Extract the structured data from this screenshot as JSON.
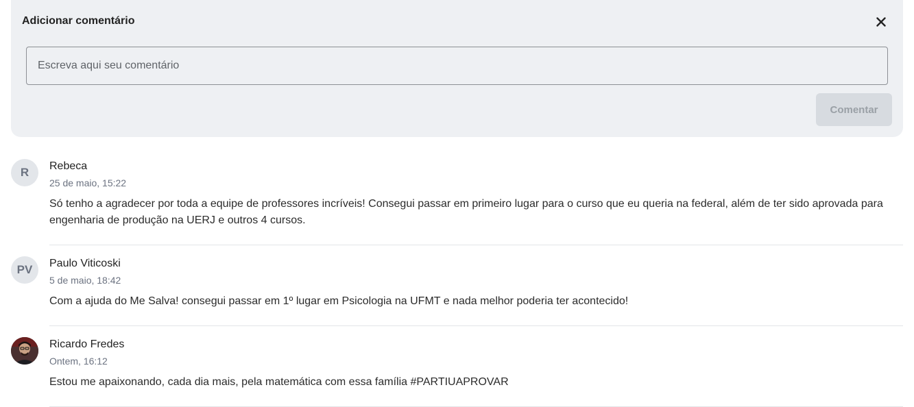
{
  "composer": {
    "title": "Adicionar comentário",
    "placeholder": "Escreva aqui seu comentário",
    "value": "",
    "submit_label": "Comentar"
  },
  "comments": [
    {
      "initials": "R",
      "author": "Rebeca",
      "date": "25 de maio, 15:22",
      "text": "Só tenho a agradecer por toda a equipe de professores incríveis! Consegui passar em primeiro lugar para o curso que eu queria na federal, além de ter sido aprovada para engenharia de produção na UERJ e outros 4 cursos."
    },
    {
      "initials": "PV",
      "author": "Paulo Viticoski",
      "date": "5 de maio, 18:42",
      "text": "Com a ajuda do Me Salva! consegui passar em 1º lugar em Psicologia na UFMT e nada melhor poderia ter acontecido!"
    },
    {
      "initials": "",
      "author": "Ricardo Fredes",
      "date": "Ontem, 16:12",
      "text": "Estou me apaixonando, cada dia mais, pela matemática com essa família #PARTIUAPROVAR"
    }
  ]
}
